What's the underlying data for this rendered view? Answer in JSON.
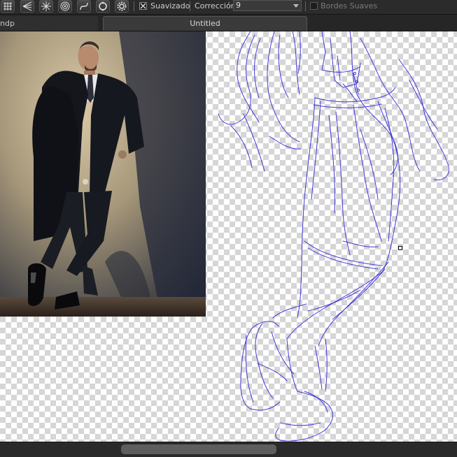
{
  "toolbar": {
    "tools": [
      {
        "name": "grid-guide-icon"
      },
      {
        "name": "perspective-guide-icon"
      },
      {
        "name": "radial-guide-icon"
      },
      {
        "name": "concentric-guide-icon"
      },
      {
        "name": "curve-guide-icon"
      },
      {
        "name": "ring-guide-icon"
      },
      {
        "name": "settings-gear-icon"
      }
    ],
    "smoothing_label": "Suavizado",
    "smoothing_checked": true,
    "correction_label": "Corrección",
    "correction_value": "9",
    "soft_edges_label": "Bordes Suaves",
    "soft_edges_checked": false
  },
  "tabs": {
    "left_tab_label": "ndp",
    "active_tab_label": "Untitled"
  },
  "colors": {
    "sketch_stroke": "#3a2fd6",
    "toolbar_bg": "#2b2b2b",
    "canvas_checker": "#d6d6d6"
  }
}
